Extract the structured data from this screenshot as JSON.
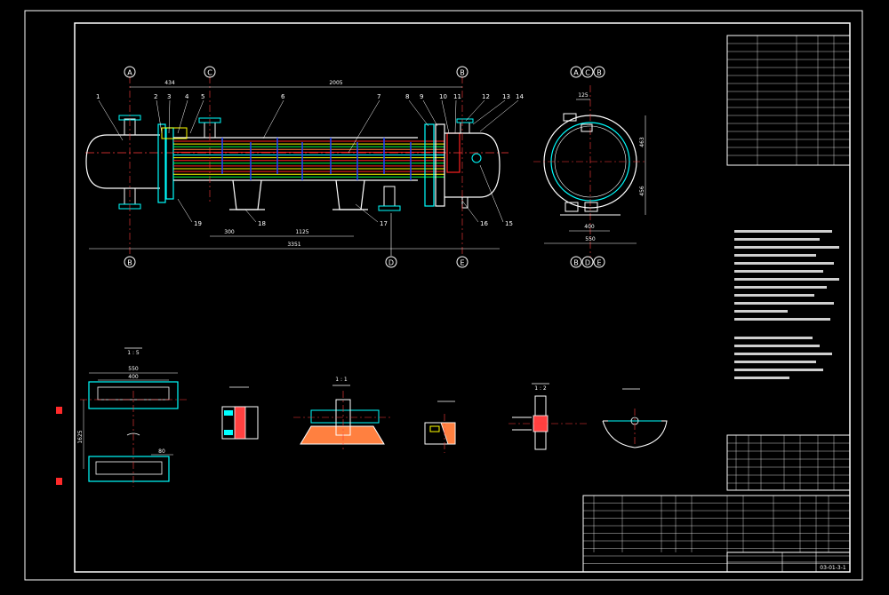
{
  "colors": {
    "background": "#000000",
    "line": "#ffffff",
    "centerline": "#ff3b3b",
    "cyan": "#00ffff",
    "yellow": "#ffff00",
    "green": "#00ff40",
    "red": "#ff2020",
    "blue": "#2040ff",
    "magenta": "#ff40ff"
  },
  "main_view": {
    "axes_top": [
      "A",
      "C",
      "B"
    ],
    "axes_bottom": [
      "B",
      "D",
      "E"
    ],
    "dims": {
      "d434": "434",
      "d2005": "2005",
      "d300": "300",
      "d1125": "1125",
      "d3351": "3351"
    },
    "callouts_top": [
      "1",
      "2",
      "3",
      "4",
      "5",
      "6",
      "7",
      "8",
      "9",
      "10",
      "11",
      "12",
      "13",
      "14"
    ],
    "callouts_bottom": [
      "19",
      "18",
      "17",
      "16",
      "15"
    ]
  },
  "end_view": {
    "axes_top": [
      "A",
      "C",
      "B"
    ],
    "axes_bottom": [
      "B",
      "D",
      "E"
    ],
    "dims": {
      "d125": "125",
      "d463": "463",
      "d456": "456",
      "d400": "400",
      "d550": "550"
    }
  },
  "detail_views": {
    "scale_1_5": "1 : 5",
    "dims": {
      "d550": "550",
      "d400": "400",
      "d80": "80",
      "d1625": "1625"
    },
    "scale_1_1": "1 : 1",
    "scale_1_2": "1 : 2"
  },
  "title_block": {
    "drawing_no": "03-01-3-1"
  }
}
